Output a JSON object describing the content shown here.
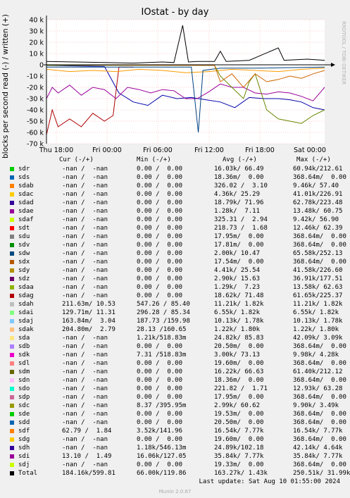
{
  "chart_data": {
    "type": "line",
    "title": "IOstat - by day",
    "ylabel": "blocks per second read (-) / written (+)",
    "ylim": [
      -70000,
      40000
    ],
    "y_ticks": [
      "40 k",
      "30 k",
      "20 k",
      "10 k",
      "0",
      "-10 k",
      "-20 k",
      "-30 k",
      "-40 k",
      "-50 k",
      "-60 k",
      "-70 k"
    ],
    "x_ticks": [
      "Thu 18:00",
      "Fri 00:00",
      "Fri 06:00",
      "Fri 12:00",
      "Fri 18:00",
      "Sat 00:00"
    ],
    "grid": true,
    "legend_position": "bottom",
    "series": [
      {
        "name": "sdh",
        "color": "#0000aa",
        "points": [
          [
            0,
            -500
          ],
          [
            50,
            -1000
          ],
          [
            100,
            -1500
          ],
          [
            125,
            -25000
          ],
          [
            150,
            -33000
          ],
          [
            175,
            -36000
          ],
          [
            200,
            -27000
          ],
          [
            225,
            -30000
          ],
          [
            250,
            -29000
          ],
          [
            275,
            -31000
          ],
          [
            300,
            -33000
          ],
          [
            325,
            -38000
          ],
          [
            350,
            -29000
          ],
          [
            375,
            -30000
          ],
          [
            400,
            -30000
          ],
          [
            420,
            -31000
          ],
          [
            440,
            -33000
          ],
          [
            460,
            -38000
          ],
          [
            480,
            -40000
          ]
        ]
      },
      {
        "name": "sdk",
        "color": "#aa0000",
        "points": [
          [
            0,
            -62000
          ],
          [
            10,
            -40000
          ],
          [
            20,
            -55000
          ],
          [
            40,
            -48000
          ],
          [
            60,
            -55000
          ],
          [
            80,
            -43000
          ],
          [
            100,
            -50000
          ],
          [
            115,
            -45000
          ],
          [
            125,
            -2000
          ],
          [
            150,
            -2000
          ]
        ]
      },
      {
        "name": "sdai",
        "color": "#990099",
        "points": [
          [
            0,
            -30000
          ],
          [
            10,
            -20000
          ],
          [
            20,
            -25000
          ],
          [
            40,
            -18000
          ],
          [
            60,
            -27000
          ],
          [
            80,
            -20000
          ],
          [
            100,
            -22000
          ],
          [
            120,
            -30000
          ],
          [
            140,
            -20000
          ],
          [
            160,
            -22000
          ],
          [
            180,
            -25000
          ],
          [
            200,
            -22000
          ],
          [
            220,
            -23000
          ],
          [
            240,
            -30000
          ],
          [
            260,
            -30000
          ],
          [
            280,
            -24000
          ],
          [
            300,
            -17000
          ],
          [
            320,
            -20000
          ],
          [
            340,
            -20000
          ],
          [
            360,
            -25000
          ],
          [
            380,
            -26000
          ],
          [
            400,
            -24000
          ],
          [
            420,
            -25000
          ],
          [
            440,
            -28000
          ],
          [
            460,
            -32000
          ],
          [
            480,
            -20000
          ]
        ]
      },
      {
        "name": "sdf",
        "color": "#ff9900",
        "points": [
          [
            0,
            -4000
          ],
          [
            40,
            -6000
          ],
          [
            80,
            -5000
          ],
          [
            120,
            -6000
          ],
          [
            160,
            -4000
          ],
          [
            200,
            -5000
          ],
          [
            240,
            -7000
          ],
          [
            280,
            -6000
          ],
          [
            320,
            -4000
          ],
          [
            360,
            -5000
          ],
          [
            400,
            -6000
          ],
          [
            440,
            -4000
          ],
          [
            480,
            -3000
          ]
        ]
      },
      {
        "name": "sds",
        "color": "#004080",
        "points": [
          [
            0,
            -2000
          ],
          [
            250,
            -2000
          ],
          [
            262,
            -60000
          ],
          [
            270,
            -5000
          ],
          [
            300,
            -3000
          ],
          [
            360,
            -3000
          ],
          [
            480,
            -2000
          ]
        ]
      },
      {
        "name": "sdu",
        "color": "#668800",
        "points": [
          [
            0,
            -500
          ],
          [
            290,
            -500
          ],
          [
            300,
            -10000
          ],
          [
            320,
            -20000
          ],
          [
            340,
            -30000
          ],
          [
            350,
            -15000
          ],
          [
            360,
            -8000
          ],
          [
            380,
            -40000
          ],
          [
            400,
            -48000
          ],
          [
            420,
            -50000
          ],
          [
            440,
            -52000
          ],
          [
            460,
            -45000
          ],
          [
            480,
            -40000
          ]
        ]
      },
      {
        "name": "sdag",
        "color": "#cc6600",
        "points": [
          [
            0,
            0
          ],
          [
            290,
            -500
          ],
          [
            300,
            -15000
          ],
          [
            320,
            -8000
          ],
          [
            340,
            -20000
          ],
          [
            360,
            -8000
          ],
          [
            380,
            -15000
          ],
          [
            400,
            -13000
          ],
          [
            420,
            -10000
          ],
          [
            440,
            -12000
          ],
          [
            460,
            -8000
          ],
          [
            480,
            -5000
          ]
        ]
      },
      {
        "name": "Total",
        "color": "#000000",
        "points": [
          [
            0,
            3000
          ],
          [
            100,
            2000
          ],
          [
            150,
            1500
          ],
          [
            175,
            2000
          ],
          [
            200,
            2500
          ],
          [
            220,
            2000
          ],
          [
            235,
            35000
          ],
          [
            245,
            2500
          ],
          [
            260,
            3000
          ],
          [
            290,
            3000
          ],
          [
            300,
            12000
          ],
          [
            310,
            3000
          ],
          [
            350,
            4000
          ],
          [
            400,
            15000
          ],
          [
            410,
            4000
          ],
          [
            450,
            5000
          ],
          [
            480,
            4000
          ]
        ]
      }
    ]
  },
  "title": "IOstat - by day",
  "y_axis_label": "blocks per second read (-) / written (+)",
  "watermark": "RRDTOOL / TOBI OETIKER",
  "legend_headers": {
    "cur": "Cur (-/+)",
    "min": "Min (-/+)",
    "avg": "Avg (-/+)",
    "max": "Max (-/+)"
  },
  "legend": [
    {
      "name": "sdr",
      "color": "#00cc00",
      "cur": "-nan /  -nan",
      "min": "0.00 /  0.00",
      "avg": "16.03k/ 66.49",
      "max": "60.94k/212.61"
    },
    {
      "name": "sds",
      "color": "#0066b3",
      "cur": "-nan /  -nan",
      "min": "0.00 /  0.00",
      "avg": "18.36m/  0.00",
      "max": "368.64m/  0.00"
    },
    {
      "name": "sdab",
      "color": "#ff8000",
      "cur": "-nan /  -nan",
      "min": "0.00 /  0.00",
      "avg": "326.02 /  3.10",
      "max": "9.46k/ 57.40"
    },
    {
      "name": "sdac",
      "color": "#ffcc00",
      "cur": "-nan /  -nan",
      "min": "0.00 /  0.00",
      "avg": "4.36k/ 25.29",
      "max": "41.01k/226.91"
    },
    {
      "name": "sdad",
      "color": "#330099",
      "cur": "-nan /  -nan",
      "min": "0.00 /  0.00",
      "avg": "18.79k/ 71.96",
      "max": "62.78k/223.48"
    },
    {
      "name": "sdae",
      "color": "#990099",
      "cur": "-nan /  -nan",
      "min": "0.00 /  0.00",
      "avg": "1.28k/  7.11",
      "max": "13.48k/ 60.75"
    },
    {
      "name": "sdaf",
      "color": "#ccff00",
      "cur": "-nan /  -nan",
      "min": "0.00 /  0.00",
      "avg": "325.31 /  2.94",
      "max": "9.42k/ 56.90"
    },
    {
      "name": "sdt",
      "color": "#ff0000",
      "cur": "-nan /  -nan",
      "min": "0.00 /  0.00",
      "avg": "218.73 /  1.68",
      "max": "12.46k/ 62.39"
    },
    {
      "name": "sdu",
      "color": "#808080",
      "cur": "-nan /  -nan",
      "min": "0.00 /  0.00",
      "avg": "17.95m/  0.00",
      "max": "368.64m/  0.00"
    },
    {
      "name": "sdv",
      "color": "#008f00",
      "cur": "-nan /  -nan",
      "min": "0.00 /  0.00",
      "avg": "17.81m/  0.00",
      "max": "368.64m/  0.00"
    },
    {
      "name": "sdw",
      "color": "#00487d",
      "cur": "-nan /  -nan",
      "min": "0.00 /  0.00",
      "avg": "2.00k/ 10.47",
      "max": "65.58k/252.13"
    },
    {
      "name": "sdx",
      "color": "#b35a00",
      "cur": "-nan /  -nan",
      "min": "0.00 /  0.00",
      "avg": "17.54m/  0.00",
      "max": "368.64m/  0.00"
    },
    {
      "name": "sdy",
      "color": "#b38f00",
      "cur": "-nan /  -nan",
      "min": "0.00 /  0.00",
      "avg": "4.41k/ 25.54",
      "max": "41.58k/226.60"
    },
    {
      "name": "sdz",
      "color": "#6b006b",
      "cur": "-nan /  -nan",
      "min": "0.00 /  0.00",
      "avg": "2.90k/ 15.63",
      "max": "36.91k/177.51"
    },
    {
      "name": "sdaa",
      "color": "#8fb300",
      "cur": "-nan /  -nan",
      "min": "0.00 /  0.00",
      "avg": "1.29k/  7.23",
      "max": "13.58k/ 62.63"
    },
    {
      "name": "sdag",
      "color": "#b30000",
      "cur": "-nan /  -nan",
      "min": "0.00 /  0.00",
      "avg": "18.62k/ 71.48",
      "max": "61.65k/225.37"
    },
    {
      "name": "sdah",
      "color": "#bebebe",
      "cur": "211.63m/ 10.53",
      "min": "547.26 / 85.40",
      "avg": "11.21k/ 1.82k",
      "max": "11.21k/ 1.82k"
    },
    {
      "name": "sdai",
      "color": "#80ff80",
      "cur": "129.71m/ 11.31",
      "min": "296.28 / 85.34",
      "avg": "6.55k/ 1.82k",
      "max": "6.55k/ 1.82k"
    },
    {
      "name": "sdaj",
      "color": "#80c9ff",
      "cur": "163.84m/  3.04",
      "min": "187.73 /159.98",
      "avg": "10.13k/ 1.78k",
      "max": "10.13k/ 1.78k"
    },
    {
      "name": "sdak",
      "color": "#ffc080",
      "cur": "204.80m/  2.79",
      "min": "28.13 /160.65",
      "avg": "1.22k/ 1.80k",
      "max": "1.22k/ 1.80k"
    },
    {
      "name": "sda",
      "color": "#ffe680",
      "cur": "-nan /  -nan",
      "min": "1.21k/518.83m",
      "avg": "24.82k/ 85.83",
      "max": "42.09k/ 3.09k"
    },
    {
      "name": "sdb",
      "color": "#aa80ff",
      "cur": "-nan /  -nan",
      "min": "0.00 /  0.00",
      "avg": "20.50m/  0.00",
      "max": "368.64m/  0.00"
    },
    {
      "name": "sdk",
      "color": "#ee00cc",
      "cur": "-nan /  -nan",
      "min": "7.31 /518.83m",
      "avg": "3.00k/ 73.13",
      "max": "9.98k/ 4.28k"
    },
    {
      "name": "sdl",
      "color": "#ff8080",
      "cur": "-nan /  -nan",
      "min": "0.00 /  0.00",
      "avg": "19.60m/  0.00",
      "max": "368.64m/  0.00"
    },
    {
      "name": "sdm",
      "color": "#666600",
      "cur": "-nan /  -nan",
      "min": "0.00 /  0.00",
      "avg": "16.22k/ 66.63",
      "max": "61.40k/212.12"
    },
    {
      "name": "sdn",
      "color": "#ffbfff",
      "cur": "-nan /  -nan",
      "min": "0.00 /  0.00",
      "avg": "18.36m/  0.00",
      "max": "368.64m/  0.00"
    },
    {
      "name": "sdo",
      "color": "#00ffcc",
      "cur": "-nan /  -nan",
      "min": "0.00 /  0.00",
      "avg": "221.82 /  1.71",
      "max": "12.93k/ 63.28"
    },
    {
      "name": "sdp",
      "color": "#cc6699",
      "cur": "-nan /  -nan",
      "min": "0.00 /  0.00",
      "avg": "17.95m/  0.00",
      "max": "368.64m/  0.00"
    },
    {
      "name": "sdc",
      "color": "#999900",
      "cur": "-nan /  -nan",
      "min": "8.37 /395.95m",
      "avg": "2.99k/ 60.62",
      "max": "9.90k/ 3.49k"
    },
    {
      "name": "sde",
      "color": "#00cc00",
      "cur": "-nan /  -nan",
      "min": "0.00 /  0.00",
      "avg": "19.53m/  0.00",
      "max": "368.64m/  0.00"
    },
    {
      "name": "sdd",
      "color": "#0066b3",
      "cur": "-nan /  -nan",
      "min": "0.00 /  0.00",
      "avg": "20.50m/  0.00",
      "max": "368.64m/  0.00"
    },
    {
      "name": "sdf",
      "color": "#ff8000",
      "cur": "62.79 /  1.84",
      "min": "3.52k/141.96",
      "avg": "16.54k/ 7.77k",
      "max": "16.54k/ 7.77k"
    },
    {
      "name": "sdg",
      "color": "#ffcc00",
      "cur": "-nan /  -nan",
      "min": "0.00 /  0.00",
      "avg": "19.60m/  0.00",
      "max": "368.64m/  0.00"
    },
    {
      "name": "sdh",
      "color": "#330099",
      "cur": "-nan /  -nan",
      "min": "1.18k/546.13m",
      "avg": "24.89k/102.18",
      "max": "42.14k/ 4.64k"
    },
    {
      "name": "sdi",
      "color": "#990099",
      "cur": "13.10 /  1.49",
      "min": "16.06k/127.05",
      "avg": "35.84k/ 7.77k",
      "max": "35.84k/ 7.77k"
    },
    {
      "name": "sdj",
      "color": "#ccff00",
      "cur": "-nan /  -nan",
      "min": "0.00 /  0.00",
      "avg": "19.33m/  0.00",
      "max": "368.64m/  0.00"
    },
    {
      "name": "Total",
      "color": "#000000",
      "cur": "184.16k/599.81",
      "min": "66.00k/119.86",
      "avg": "163.27k/ 1.43k",
      "max": "250.51k/ 31.99k"
    }
  ],
  "footer": "Last update: Sat Aug 10 01:55:00 2024",
  "munin_version": "Munin 2.0.67"
}
